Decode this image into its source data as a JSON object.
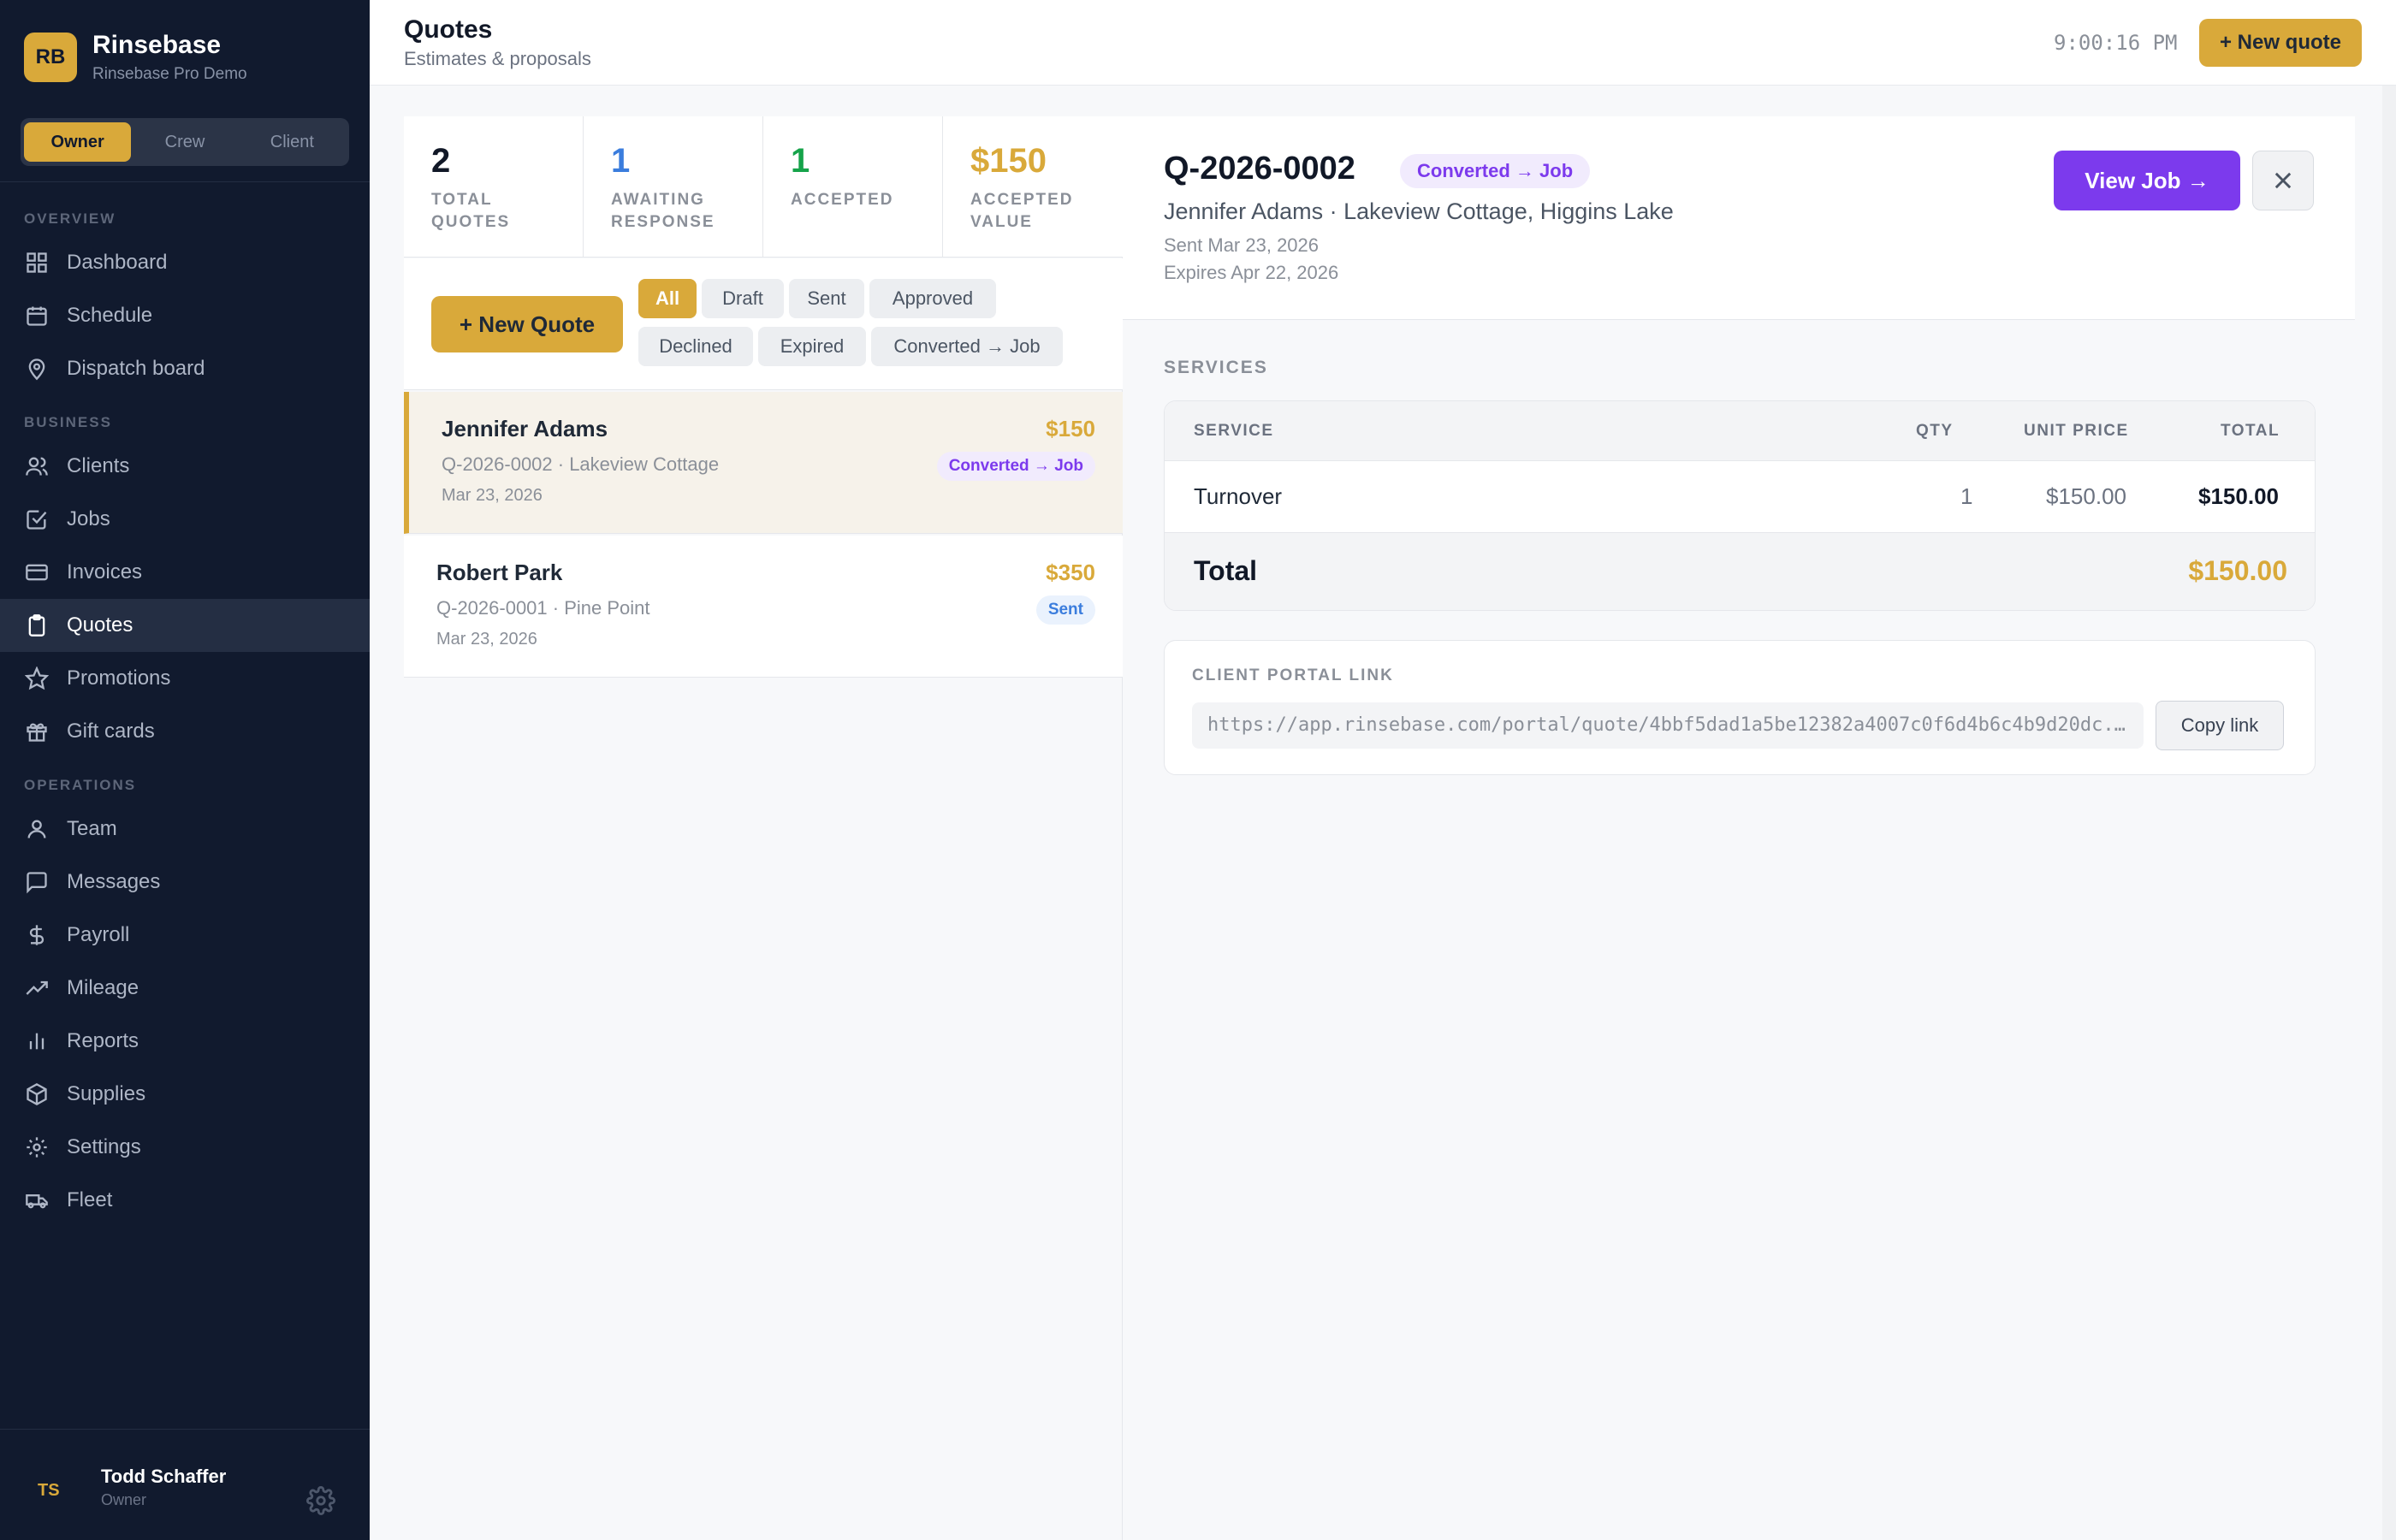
{
  "brand": {
    "logo": "RB",
    "name": "Rinsebase",
    "subtitle": "Rinsebase Pro Demo"
  },
  "roles": [
    "Owner",
    "Crew",
    "Client"
  ],
  "nav": {
    "overview_label": "OVERVIEW",
    "overview": [
      {
        "label": "Dashboard",
        "icon": "dashboard-icon"
      },
      {
        "label": "Schedule",
        "icon": "calendar-icon"
      },
      {
        "label": "Dispatch board",
        "icon": "map-pin-icon"
      }
    ],
    "business_label": "BUSINESS",
    "business": [
      {
        "label": "Clients",
        "icon": "users-icon"
      },
      {
        "label": "Jobs",
        "icon": "check-square-icon"
      },
      {
        "label": "Invoices",
        "icon": "credit-card-icon"
      },
      {
        "label": "Quotes",
        "icon": "clipboard-icon"
      },
      {
        "label": "Promotions",
        "icon": "star-icon"
      },
      {
        "label": "Gift cards",
        "icon": "gift-icon"
      }
    ],
    "operations_label": "OPERATIONS",
    "operations": [
      {
        "label": "Team",
        "icon": "user-icon"
      },
      {
        "label": "Messages",
        "icon": "message-icon"
      },
      {
        "label": "Payroll",
        "icon": "dollar-icon"
      },
      {
        "label": "Mileage",
        "icon": "trending-up-icon"
      },
      {
        "label": "Reports",
        "icon": "bar-chart-icon"
      },
      {
        "label": "Supplies",
        "icon": "box-icon"
      },
      {
        "label": "Settings",
        "icon": "gear-icon"
      },
      {
        "label": "Fleet",
        "icon": "truck-icon"
      }
    ]
  },
  "user": {
    "initials": "TS",
    "name": "Todd Schaffer",
    "role": "Owner"
  },
  "header": {
    "title": "Quotes",
    "subtitle": "Estimates & proposals",
    "clock": "9:00:16 PM",
    "new_button": "+ New quote"
  },
  "stats": [
    {
      "value": "2",
      "label": "TOTAL QUOTES",
      "color": "#111827"
    },
    {
      "value": "1",
      "label": "AWAITING RESPONSE",
      "color": "#3b7ddd"
    },
    {
      "value": "1",
      "label": "ACCEPTED",
      "color": "#16a34a"
    },
    {
      "value": "$150",
      "label": "ACCEPTED VALUE",
      "color": "#d9a93a"
    }
  ],
  "filters": {
    "new_button": "+ New Quote",
    "chips": [
      "All",
      "Draft",
      "Sent",
      "Approved",
      "Declined",
      "Expired",
      "Converted → Job"
    ]
  },
  "quotes": [
    {
      "name": "Jennifer Adams",
      "meta": "Q-2026-0002 · Lakeview Cottage",
      "date": "Mar 23, 2026",
      "amount": "$150",
      "status": "Converted → Job"
    },
    {
      "name": "Robert Park",
      "meta": "Q-2026-0001 · Pine Point",
      "date": "Mar 23, 2026",
      "amount": "$350",
      "status": "Sent"
    }
  ],
  "detail": {
    "id": "Q-2026-0002",
    "status": "Converted → Job",
    "client": "Jennifer Adams · Lakeview Cottage, Higgins Lake",
    "sent": "Sent Mar 23, 2026",
    "expires": "Expires Apr 22, 2026",
    "view_job": "View Job →",
    "services_label": "SERVICES",
    "table_headers": {
      "service": "SERVICE",
      "qty": "QTY",
      "unit_price": "UNIT PRICE",
      "total": "TOTAL"
    },
    "services": [
      {
        "service": "Turnover",
        "qty": "1",
        "unit_price": "$150.00",
        "total": "$150.00"
      }
    ],
    "total_label": "Total",
    "total_value": "$150.00",
    "portal_label": "CLIENT PORTAL LINK",
    "portal_url": "https://app.rinsebase.com/portal/quote/4bbf5dad1a5be12382a4007c0f6d4b6c4b9d20dc...",
    "copy_button": "Copy link"
  }
}
